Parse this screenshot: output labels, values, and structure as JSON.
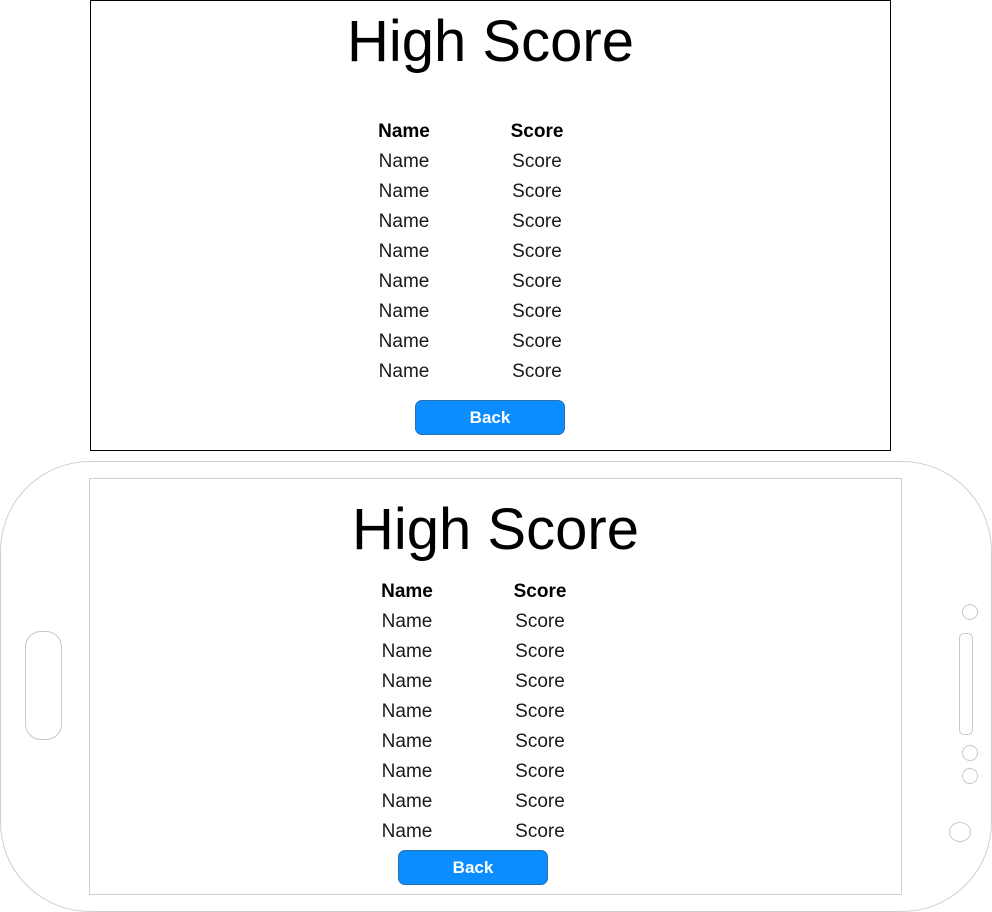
{
  "top_panel": {
    "title": "High Score",
    "header": {
      "name": "Name",
      "score": "Score"
    },
    "rows": [
      {
        "name": "Name",
        "score": "Score"
      },
      {
        "name": "Name",
        "score": "Score"
      },
      {
        "name": "Name",
        "score": "Score"
      },
      {
        "name": "Name",
        "score": "Score"
      },
      {
        "name": "Name",
        "score": "Score"
      },
      {
        "name": "Name",
        "score": "Score"
      },
      {
        "name": "Name",
        "score": "Score"
      },
      {
        "name": "Name",
        "score": "Score"
      }
    ],
    "back_label": "Back"
  },
  "phone_screen": {
    "title": "High Score",
    "header": {
      "name": "Name",
      "score": "Score"
    },
    "rows": [
      {
        "name": "Name",
        "score": "Score"
      },
      {
        "name": "Name",
        "score": "Score"
      },
      {
        "name": "Name",
        "score": "Score"
      },
      {
        "name": "Name",
        "score": "Score"
      },
      {
        "name": "Name",
        "score": "Score"
      },
      {
        "name": "Name",
        "score": "Score"
      },
      {
        "name": "Name",
        "score": "Score"
      },
      {
        "name": "Name",
        "score": "Score"
      }
    ],
    "back_label": "Back"
  },
  "colors": {
    "button_fill": "#0b8dff",
    "button_text": "#ffffff",
    "phone_outline": "#cfcfcf"
  }
}
